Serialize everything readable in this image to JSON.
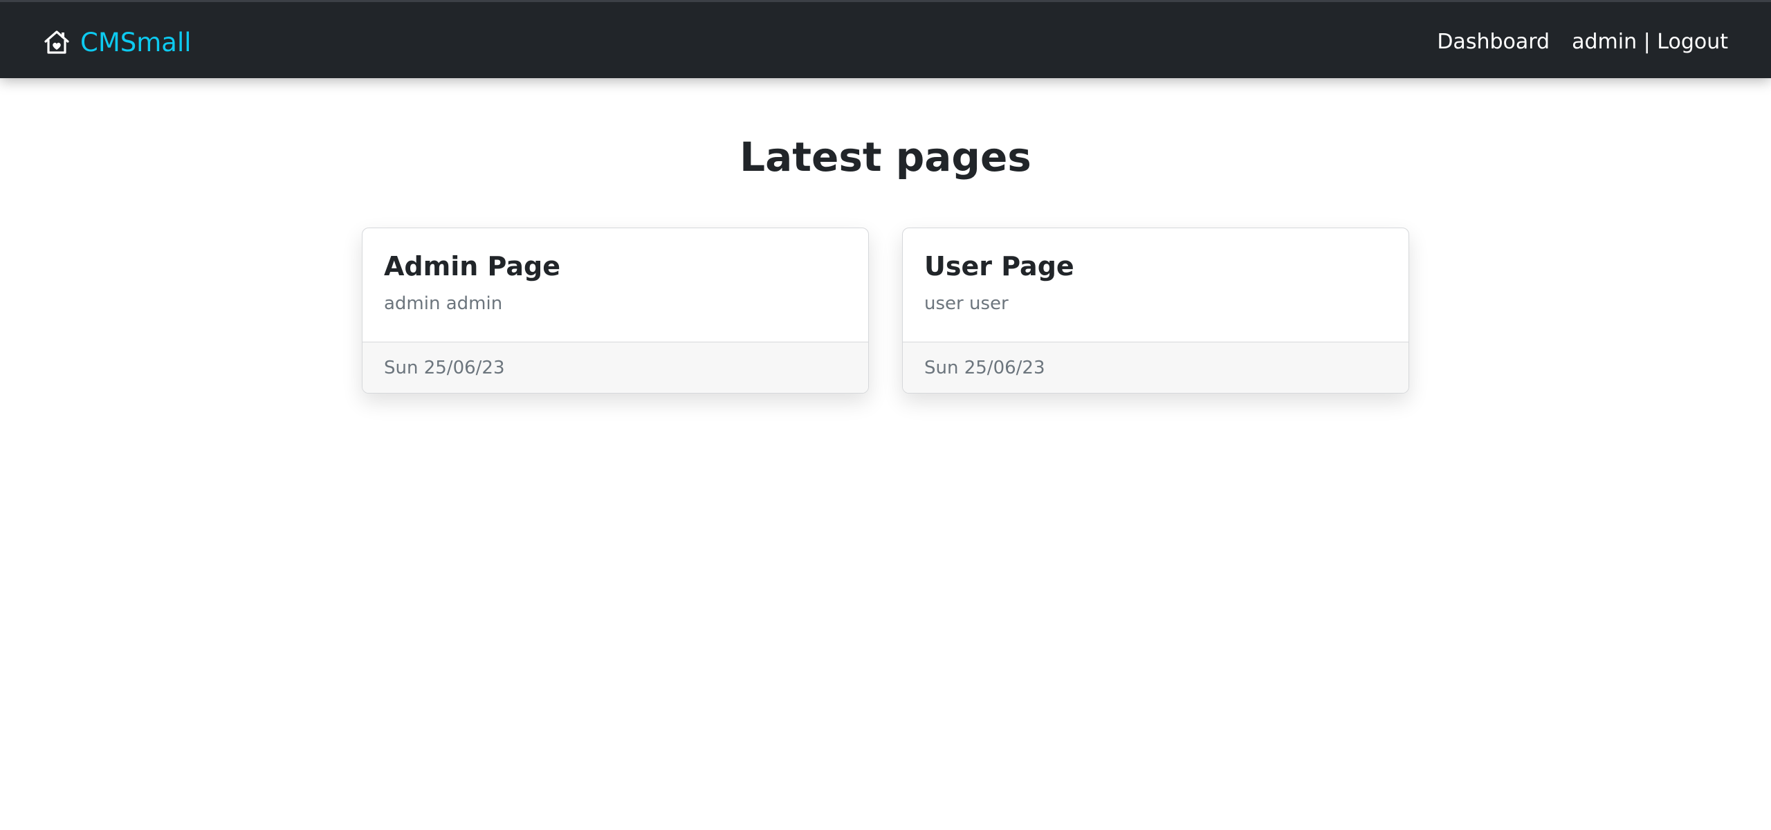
{
  "navbar": {
    "brand": {
      "icon": "house-heart-icon",
      "name": "CMSmall",
      "color": "#0dcaf0"
    },
    "links": {
      "dashboard": "Dashboard",
      "user_logout": "admin | Logout"
    },
    "background": "#212529"
  },
  "main": {
    "title": "Latest pages",
    "cards": [
      {
        "title": "Admin Page",
        "author": "admin admin",
        "date": "Sun 25/06/23"
      },
      {
        "title": "User Page",
        "author": "user user",
        "date": "Sun 25/06/23"
      }
    ]
  }
}
